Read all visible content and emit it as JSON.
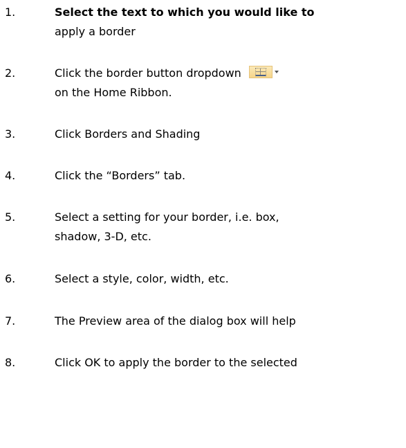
{
  "steps": [
    {
      "number": "1.",
      "lines": [
        "Select the text to which you would like to",
        "apply a border"
      ]
    },
    {
      "number": "2.",
      "lines": [
        "Click the border button dropdown",
        "on the Home Ribbon."
      ],
      "icon": "border-dropdown-icon"
    },
    {
      "number": "3.",
      "lines": [
        "Click Borders and Shading"
      ]
    },
    {
      "number": "4.",
      "lines": [
        "Click the “Borders” tab."
      ]
    },
    {
      "number": "5.",
      "lines": [
        "Select a setting for your border, i.e. box,",
        "shadow, 3-D, etc."
      ]
    },
    {
      "number": "6.",
      "lines": [
        "Select a style, color, width, etc."
      ]
    },
    {
      "number": "7.",
      "lines": [
        "The Preview area of the dialog box will help"
      ]
    },
    {
      "number": "8.",
      "lines": [
        "Click OK to apply the border to the selected"
      ]
    }
  ],
  "colors": {
    "text": "#000000",
    "background": "#ffffff",
    "icon_highlight": "#f6d58a"
  }
}
